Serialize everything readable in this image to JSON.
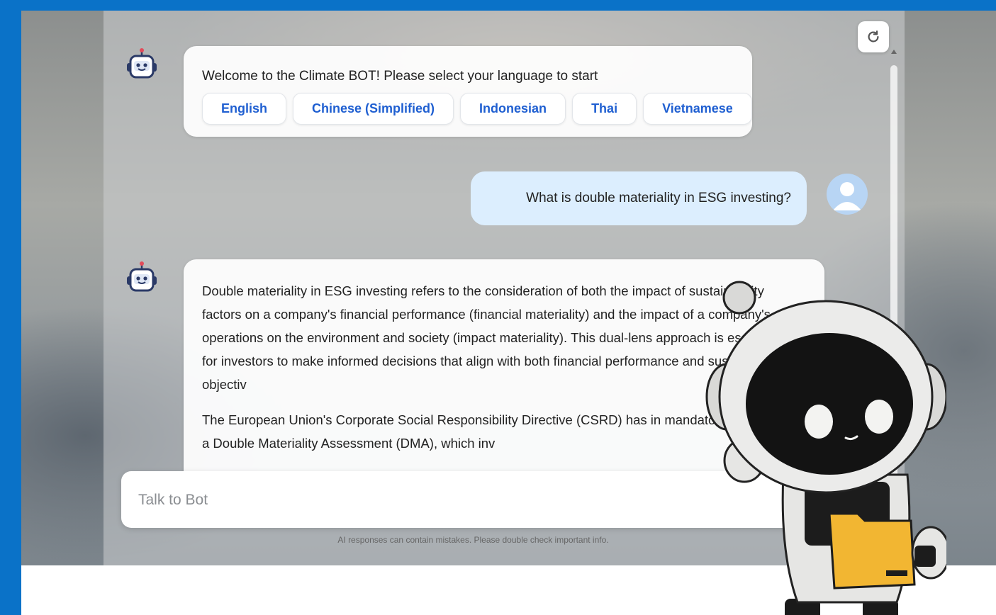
{
  "chat": {
    "welcome": {
      "text": "Welcome to the Climate BOT! Please select your language to start",
      "languages": [
        "English",
        "Chinese (Simplified)",
        "Indonesian",
        "Thai",
        "Vietnamese"
      ]
    },
    "user_message": "What is double materiality in ESG investing?",
    "bot_answer": {
      "paragraph_1": "Double materiality in ESG investing refers to the consideration of both the impact of sustainability factors on a company's financial performance (financial materiality) and the impact of a company's operations on the environment and society (impact materiality). This dual-lens approach is essential for investors to make informed decisions that align with both financial performance and sustainability objectiv",
      "paragraph_2": "The European Union's Corporate Social Responsibility Directive (CSRD) has in mandatory reporting of a Double Materiality Assessment (DMA), which inv"
    }
  },
  "input": {
    "placeholder": "Talk to Bot"
  },
  "disclaimer": "AI responses can contain mistakes. Please double check important info.",
  "icons": {
    "bot": "robot-icon",
    "user": "user-avatar-icon",
    "refresh": "refresh-icon"
  },
  "colors": {
    "frame": "#0a72c8",
    "language_button_text": "#1f5fd1",
    "user_bubble": "#dceefe"
  }
}
